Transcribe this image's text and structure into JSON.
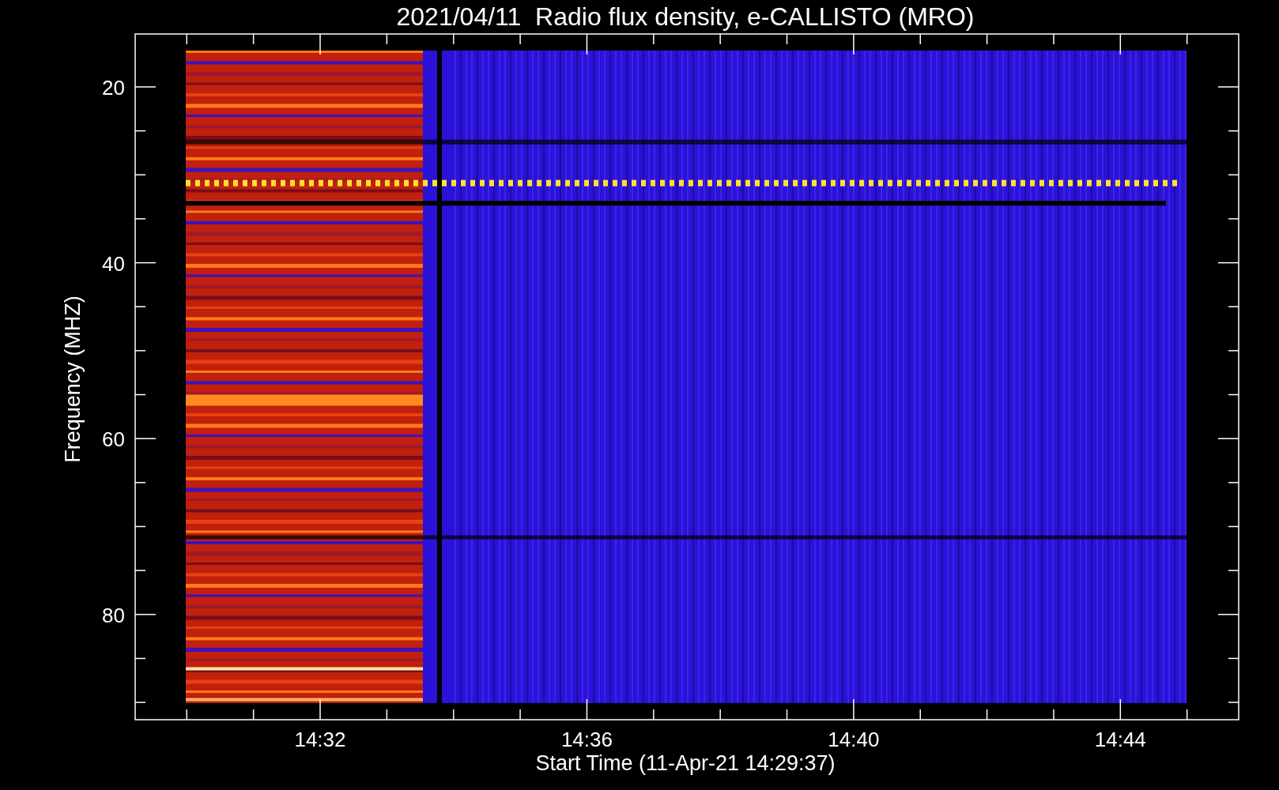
{
  "title": "2021/04/11  Radio flux density, e-CALLISTO (MRO)",
  "y_axis": {
    "label": "Frequency (MHZ)",
    "ticks": [
      "20",
      "40",
      "60",
      "80"
    ]
  },
  "x_axis": {
    "label": "Start Time (11-Apr-21 14:29:37)",
    "ticks": [
      "14:32",
      "14:36",
      "14:40",
      "14:44"
    ]
  }
}
